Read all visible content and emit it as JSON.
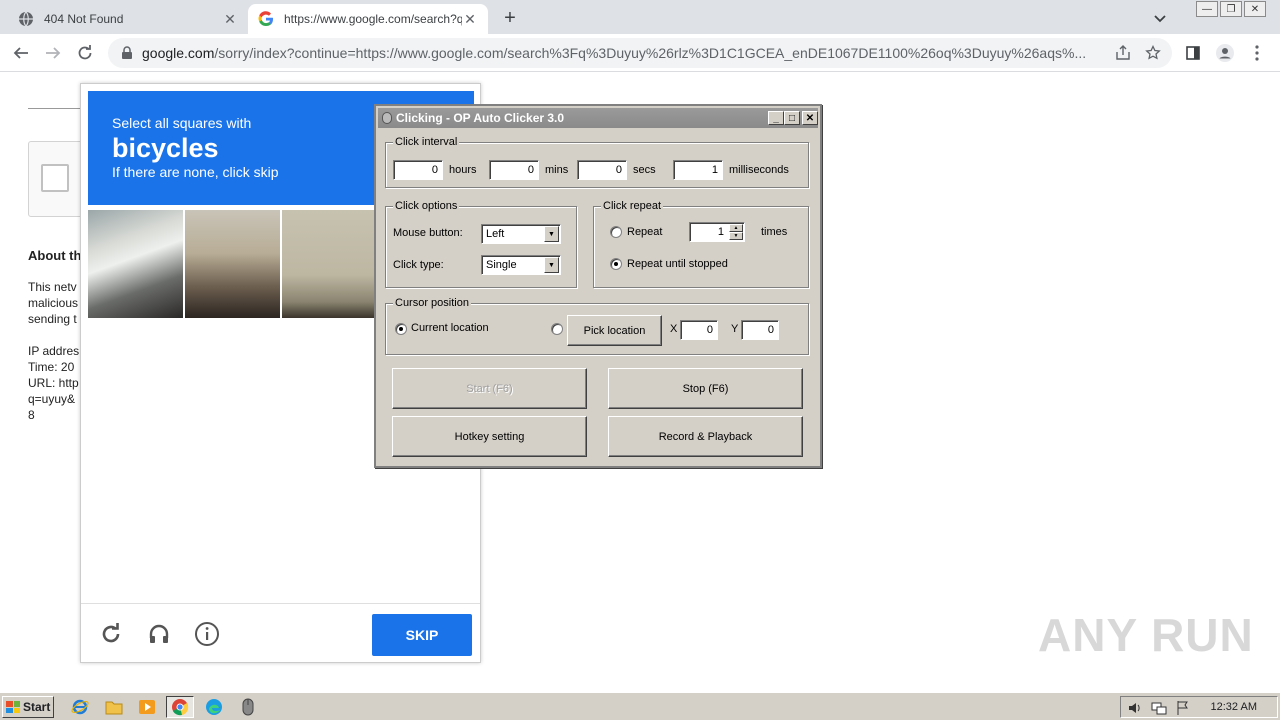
{
  "tabs": [
    {
      "title": "404 Not Found",
      "active": false
    },
    {
      "title": "https://www.google.com/search?q=",
      "active": true
    }
  ],
  "address": {
    "host": "google.com",
    "path": "/sorry/index?continue=https://www.google.com/search%3Fq%3Duyuy%26rlz%3D1C1GCEA_enDE1067DE1100%26oq%3Duyuy%26aqs%..."
  },
  "page": {
    "about_heading": "About th",
    "body_lines": [
      "This netv",
      "malicious",
      "sending t"
    ],
    "info_lines": [
      "IP addres",
      "Time: 20",
      "URL: http",
      "q=uyuy&",
      "8"
    ]
  },
  "captcha": {
    "line1": "Select all squares with",
    "target": "bicycles",
    "line3": "If there are none, click skip",
    "skip_label": "SKIP",
    "accent": "#1a73e8"
  },
  "clicker": {
    "title": "Clicking - OP Auto Clicker 3.0",
    "interval": {
      "legend": "Click interval",
      "hours": "0",
      "hours_label": "hours",
      "mins": "0",
      "mins_label": "mins",
      "secs": "0",
      "secs_label": "secs",
      "ms": "1",
      "ms_label": "milliseconds"
    },
    "options": {
      "legend": "Click options",
      "mouse_button_label": "Mouse button:",
      "mouse_button": "Left",
      "click_type_label": "Click type:",
      "click_type": "Single"
    },
    "repeat": {
      "legend": "Click repeat",
      "repeat_label": "Repeat",
      "repeat_count": "1",
      "times_label": "times",
      "until_stopped_label": "Repeat until stopped",
      "selected": "until_stopped"
    },
    "cursor": {
      "legend": "Cursor position",
      "current_label": "Current location",
      "pick_label": "Pick location",
      "x_label": "X",
      "x": "0",
      "y_label": "Y",
      "y": "0",
      "selected": "current"
    },
    "buttons": {
      "start": "Start (F6)",
      "stop": "Stop (F6)",
      "hotkey": "Hotkey setting",
      "record": "Record & Playback"
    }
  },
  "watermark": "ANY RUN",
  "taskbar": {
    "start_label": "Start",
    "clock": "12:32 AM"
  }
}
